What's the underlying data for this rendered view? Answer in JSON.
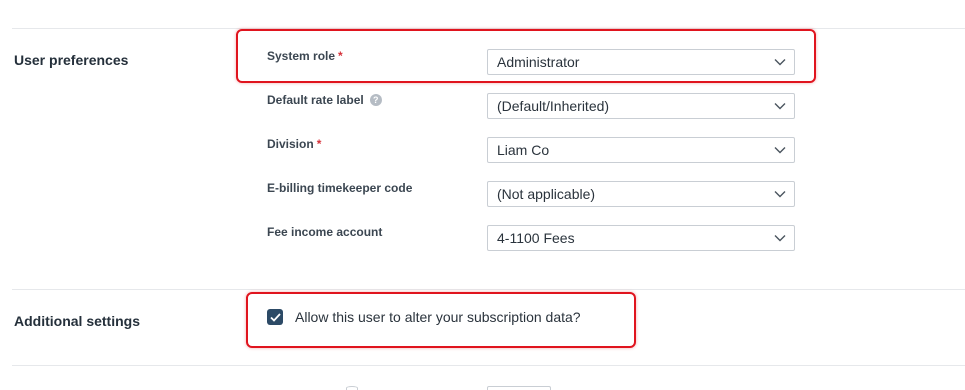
{
  "sections": {
    "user_preferences": {
      "title": "User preferences",
      "fields": [
        {
          "label": "System role",
          "required": true,
          "value": "Administrator"
        },
        {
          "label": "Default rate label",
          "required": false,
          "help": "?",
          "value": "(Default/Inherited)"
        },
        {
          "label": "Division",
          "required": true,
          "value": "Liam Co"
        },
        {
          "label": "E-billing timekeeper code",
          "required": false,
          "value": "(Not applicable)"
        },
        {
          "label": "Fee income account",
          "required": false,
          "value": "4-1100 Fees"
        }
      ]
    },
    "additional_settings": {
      "title": "Additional settings",
      "checkbox_label": "Allow this user to alter your subscription data?",
      "checked": true
    }
  },
  "required_marker": "*",
  "colors": {
    "highlight": "#e0141e",
    "checkbox": "#2c4a66",
    "required": "#d6323b"
  }
}
